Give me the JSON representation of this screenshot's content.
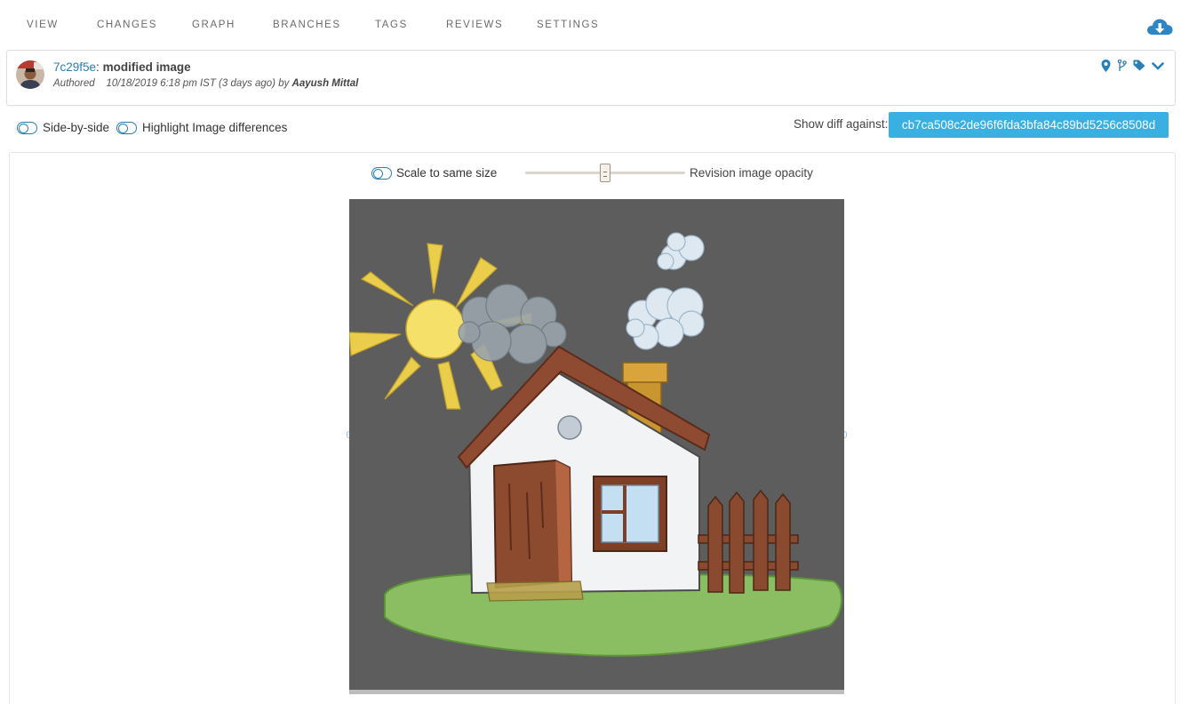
{
  "nav": {
    "tabs": [
      {
        "label": "VIEW"
      },
      {
        "label": "CHANGES"
      },
      {
        "label": "GRAPH"
      },
      {
        "label": "BRANCHES"
      },
      {
        "label": "TAGS"
      },
      {
        "label": "REVIEWS"
      },
      {
        "label": "SETTINGS"
      }
    ],
    "download_icon": "cloud-download-icon"
  },
  "commit": {
    "sha": "7c29f5e",
    "separator": ":",
    "message": "modified image",
    "authored_label": "Authored",
    "date": "10/18/2019 6:18 pm IST (3 days ago)",
    "by_label": "by",
    "author": "Aayush Mittal",
    "icons": [
      "map-pin-icon",
      "branch-icon",
      "tag-icon",
      "chevron-down-icon"
    ]
  },
  "options": {
    "side_by_side": "Side-by-side",
    "highlight": "Highlight Image differences",
    "diff_label": "Show diff against:",
    "diff_sha": "cb7ca508c2de96f6fda3bfa84c89bd5256c8508d"
  },
  "viewer": {
    "scale_label": "Scale to same size",
    "opacity_label": "Revision image opacity",
    "opacity_value": 0.5
  },
  "colors": {
    "accent": "#2a7fb5",
    "button": "#3ab0e2",
    "canvas_bg": "#5d5d5d"
  }
}
